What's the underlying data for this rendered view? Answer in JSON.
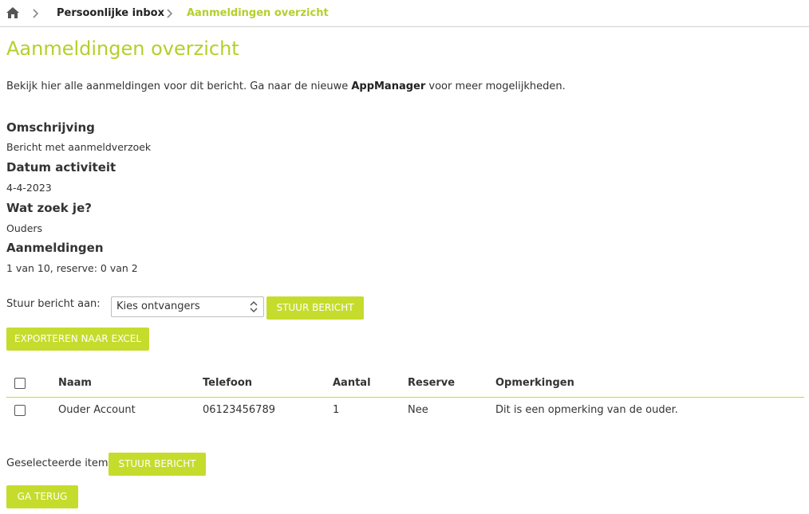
{
  "breadcrumb": {
    "home_icon": "home-icon",
    "items": [
      "Persoonlijke inbox",
      "Aanmeldingen overzicht"
    ]
  },
  "page": {
    "title": "Aanmeldingen overzicht",
    "intro_before": "Bekijk hier alle aanmeldingen voor dit bericht. Ga naar de nieuwe ",
    "intro_link": "AppManager",
    "intro_after": " voor meer mogelijkheden."
  },
  "details": {
    "omschrijving_label": "Omschrijving",
    "omschrijving_value": "Bericht met aanmeldverzoek",
    "datum_label": "Datum activiteit",
    "datum_value": "4-4-2023",
    "zoek_label": "Wat zoek je?",
    "zoek_value": "Ouders",
    "aanmeldingen_label": "Aanmeldingen",
    "aanmeldingen_value": "1 van 10, reserve: 0 van 2"
  },
  "send": {
    "label": "Stuur bericht aan:",
    "select_value": "Kies ontvangers",
    "button": "Stuur bericht"
  },
  "export_button": "Exporteren naar Excel",
  "table": {
    "headers": [
      "Naam",
      "Telefoon",
      "Aantal",
      "Reserve",
      "Opmerkingen"
    ],
    "rows": [
      [
        "Ouder Account",
        "06123456789",
        "1",
        "Nee",
        "Dit is een opmerking van de ouder."
      ]
    ]
  },
  "selected": {
    "label": "Geselecteerde items:",
    "button": "Stuur bericht"
  },
  "back_button": "Ga terug",
  "colors": {
    "accent": "#c5dc2c",
    "title": "#b5cf2a"
  }
}
